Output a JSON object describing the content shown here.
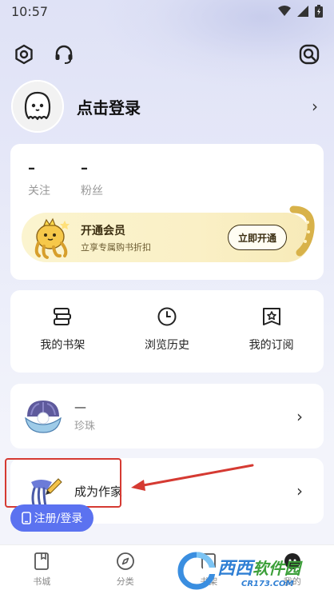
{
  "status_bar": {
    "time": "10:57"
  },
  "profile": {
    "login_text": "点击登录"
  },
  "stats": [
    {
      "value": "–",
      "label": "关注"
    },
    {
      "value": "–",
      "label": "粉丝"
    }
  ],
  "vip": {
    "title": "开通会员",
    "subtitle": "立享专属购书折扣",
    "button": "立即开通"
  },
  "quick_actions": [
    {
      "label": "我的书架",
      "icon": "bookshelf-icon"
    },
    {
      "label": "浏览历史",
      "icon": "clock-icon"
    },
    {
      "label": "我的订阅",
      "icon": "subscription-icon"
    }
  ],
  "pearl": {
    "value": "—",
    "label": "珍珠"
  },
  "writer": {
    "label": "成为作家"
  },
  "register_button": "注册/登录",
  "tabs": [
    {
      "label": "书城",
      "icon": "book-icon"
    },
    {
      "label": "分类",
      "icon": "compass-icon"
    },
    {
      "label": "书架",
      "icon": "shelf-icon"
    },
    {
      "label": "我的",
      "icon": "profile-icon"
    }
  ],
  "watermark": {
    "brand": "西西",
    "title": "软件园",
    "url": "CR173.COM"
  },
  "colors": {
    "accent": "#5b72f0",
    "highlight": "#d53a32",
    "vip_bg": "#fbf4cf"
  }
}
